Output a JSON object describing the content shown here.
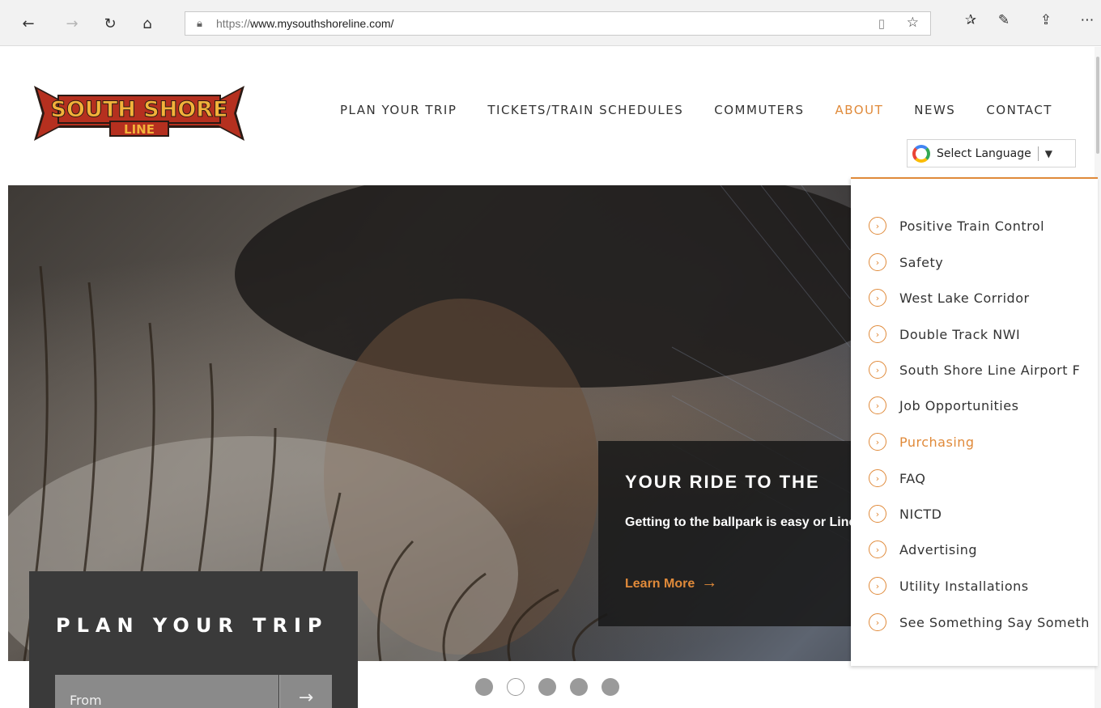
{
  "browser": {
    "url_protocol": "https://",
    "url_host": "www.mysouthshoreline.com/",
    "back_icon": "back-arrow-icon",
    "forward_icon": "forward-arrow-icon",
    "refresh_icon": "refresh-icon",
    "home_icon": "home-icon"
  },
  "logo": {
    "line1": "SOUTH SHORE",
    "line2": "LINE"
  },
  "nav": {
    "items": [
      "PLAN YOUR TRIP",
      "TICKETS/TRAIN SCHEDULES",
      "COMMUTERS",
      "ABOUT",
      "NEWS",
      "CONTACT"
    ],
    "active": "ABOUT"
  },
  "language": {
    "label": "Select Language",
    "arrow": "▼"
  },
  "dropdown": {
    "items": [
      "Positive Train Control",
      "Safety",
      "West Lake Corridor",
      "Double Track NWI",
      "South Shore Line Airport F",
      "Job Opportunities",
      "Purchasing",
      "FAQ",
      "NICTD",
      "Advertising",
      "Utility Installations",
      "See Something Say Someth"
    ],
    "active": "Purchasing"
  },
  "slide": {
    "heading": "YOUR RIDE TO THE",
    "text": "Getting to the ballpark is easy or Line.",
    "cta": "Learn More"
  },
  "trip": {
    "title": "PLAN YOUR TRIP",
    "from_placeholder": "From"
  },
  "carousel": {
    "count": 5,
    "active_index": 1
  },
  "colors": {
    "accent": "#e08a3a",
    "logo_red": "#b5301f",
    "logo_gold": "#f2b23a"
  }
}
